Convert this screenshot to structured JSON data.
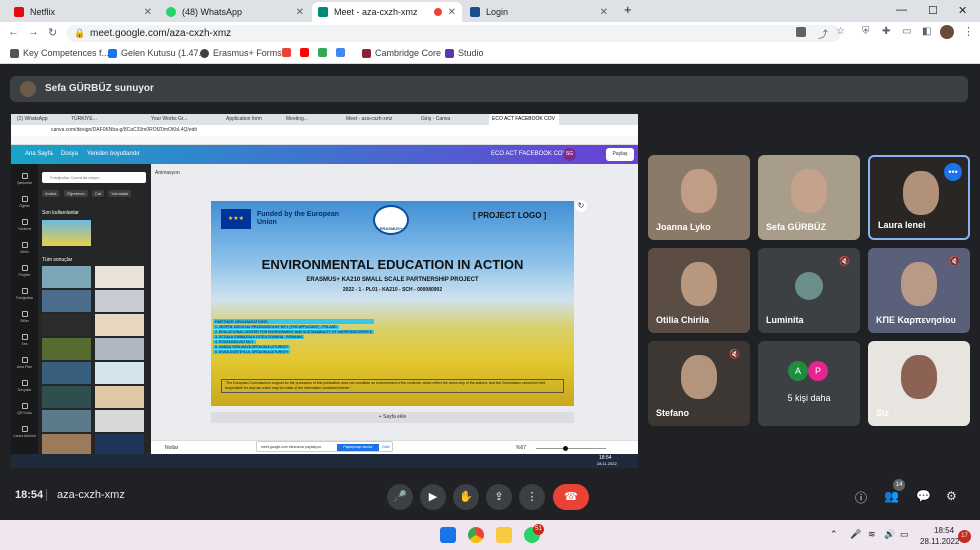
{
  "tabs": [
    {
      "title": "Netflix",
      "color": "#e50914"
    },
    {
      "title": "(48) WhatsApp",
      "color": "#25d366"
    },
    {
      "title": "Meet - aza-cxzh-xmz",
      "color": "#00897b"
    },
    {
      "title": "Login",
      "color": "#1a4f8b"
    }
  ],
  "window_controls": {
    "minimize": "—",
    "maximize": "☐",
    "close": "✕"
  },
  "address": {
    "url": "meet.google.com/aza-cxzh-xmz"
  },
  "bookmarks": [
    "Key Competences f...",
    "Gelen Kutusu (1.47...",
    "Erasmus+ Forms",
    "Cambridge Core",
    "Studio"
  ],
  "presenter_bar": "Sefa GÜRBÜZ sunuyor",
  "shared": {
    "tabs": [
      "(2) WhatsApp",
      "TÜRKİYE...",
      "Your Works Gr...",
      "Application form",
      "Meeting...",
      "Meet - aza-cxzh-xmz",
      "Giriş - Canva",
      "ECO ACT FACEBOOK COV"
    ],
    "canva_url": "canva.com/design/DAF0KNba-g/8CaC33m0ROfZ0mOKbL4Q/edit",
    "menu": [
      "Ana Sayfa",
      "Dosya",
      "Yeniden boyutlandır"
    ],
    "design_title": "ECO ACT FACEBOOK COVER",
    "share_btn": "Paylaş",
    "search_ph": "Fotoğraflar Canva'da arayın",
    "filters": [
      "Ambla",
      "Öğretmen",
      "Cat",
      "Yakındaki"
    ],
    "recent_label": "Son kullanılanlar",
    "all_label": "Tüm sonuçlar",
    "side_items": [
      "Şablonlar",
      "Öğeler",
      "Yükleme",
      "Metin",
      "Projeler",
      "Fotoğraflar",
      "Stiller",
      "Ses",
      "Arka Plan",
      "Dosyalar",
      "QR Kodu",
      "Canva Albümü"
    ],
    "animation_label": "Animasyon",
    "poster": {
      "funded": "Funded by the European Union",
      "logo_tag": "ERASMUS+",
      "project_logo": "[ PROJECT LOGO ]",
      "title": "ENVIRONMENTAL EDUCATION IN ACTION",
      "subtitle": "ERASMUS+ KA210 SMALL SCALE PARTNERSHIP PROJECT",
      "code": "2022 - 1 - PL01 - KA210 - SCH - 000080902",
      "partners_header": "PARTNER ORGANIZATIONS",
      "partners": [
        "1. ZESPÓŁ SZKOLNO-PRZEDSZKOLNY NR 1 (THE APPLICANT) - POLAND",
        "2. EDUCATIONAL CENTER FOR ENVIRONMENT AND SUSTAINABILITY OF KARPENISI/GREECE",
        "3. SCOALA GIMNAZIALA OLTEA DOAMNA - ROMANIA",
        "4. PONTASSIEVE/ITALY",
        "5. HAMZA YERLIKAYA ORTAOKULU/TURKEY",
        "6. SIVAS DORTEYLUL ORTAOKULU/TURKEY"
      ],
      "disclaimer": "\"The European Commission's support for the production of this publication does not constitute an endorsement of the contents, which reflect the views only of the authors, and the Commission cannot be held responsible for any use which may be made of the information contained therein.\""
    },
    "add_page": "+ Sayfa ekle",
    "notes": "Notlar",
    "zoom": "%67",
    "sharing_msg": "meet.google.com ekranınızı paylaşıyor.",
    "stop_share": "Paylaşmayı durdur",
    "hide": "Gizle",
    "time": "18:54",
    "date": "28.11.2022"
  },
  "participants": [
    {
      "name": "Joanna Lyko",
      "muted": false
    },
    {
      "name": "Sefa GÜRBÜZ",
      "muted": false
    },
    {
      "name": "Laura Ienei",
      "muted": false
    },
    {
      "name": "Otilia Chirila",
      "muted": false
    },
    {
      "name": "Luminita",
      "muted": true
    },
    {
      "name": "ΚΠΕ Καρπενησίου",
      "muted": true
    },
    {
      "name": "Stefano",
      "muted": true
    },
    {
      "name": "5 kişi daha",
      "muted": false
    },
    {
      "name": "Siz",
      "muted": false
    }
  ],
  "more_avatars": [
    "A",
    "P"
  ],
  "controls": {
    "time": "18:54",
    "code": "aza-cxzh-xmz",
    "people_count": "14"
  },
  "taskbar": {
    "time": "18:54",
    "date": "28.11.2022",
    "badge": "51",
    "notif": "17"
  }
}
